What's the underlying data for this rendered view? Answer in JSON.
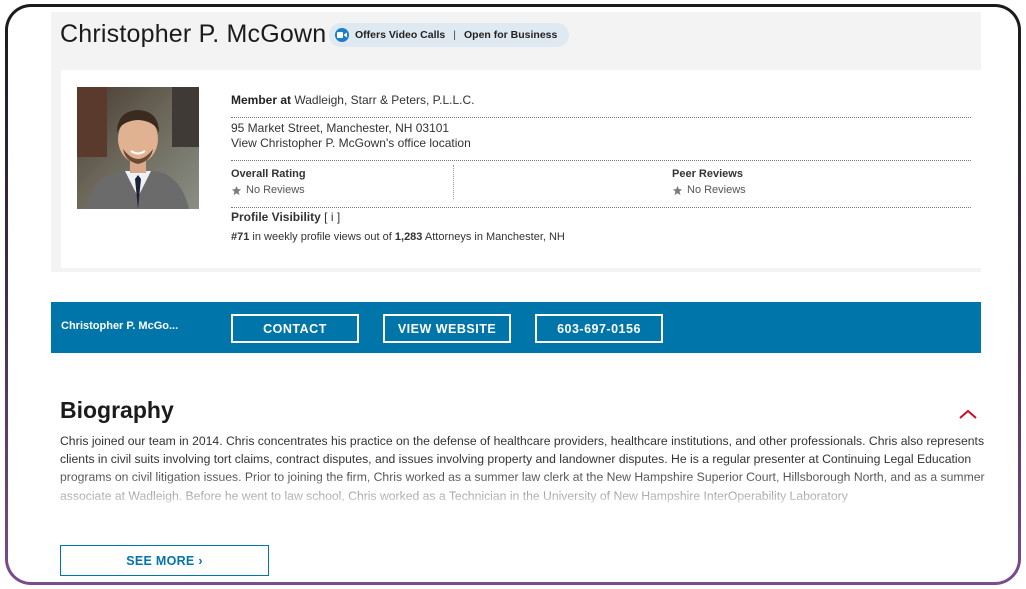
{
  "profile": {
    "name": "Christopher P. McGown",
    "badges": {
      "video": "Offers Video Calls",
      "separator": "|",
      "open": "Open for Business"
    }
  },
  "card": {
    "member_label": "Member at",
    "firm": "Wadleigh, Starr & Peters, P.L.L.C.",
    "address": "95 Market Street, Manchester, NH 03101",
    "office_link": "View Christopher P. McGown's office location",
    "overall_rating_label": "Overall Rating",
    "overall_rating_value": "No Reviews",
    "peer_reviews_label": "Peer Reviews",
    "peer_reviews_value": "No Reviews",
    "visibility_label": "Profile Visibility",
    "visibility_info": "[ i ]",
    "rank": "#71",
    "rank_text_1": "in weekly profile views out of",
    "total": "1,283",
    "rank_text_2": "Attorneys in Manchester, NH"
  },
  "action_bar": {
    "name": "Christopher P. McGo...",
    "contact": "CONTACT",
    "website": "VIEW WEBSITE",
    "phone": "603-697-0156"
  },
  "biography": {
    "title": "Biography",
    "text": "Chris joined our team in 2014. Chris concentrates his practice on the defense of healthcare providers, healthcare institutions, and other professionals. Chris also represents clients in civil suits involving tort claims, contract disputes, and issues involving property and landowner disputes. He is a regular presenter at Continuing Legal Education programs on civil litigation issues. Prior to joining the firm, Chris worked as a summer law clerk at the New Hampshire Superior Court, Hillsborough North, and as a summer associate at Wadleigh. Before he went to law school, Chris worked as a Technician in the University of New Hampshire InterOperability Laboratory",
    "see_more": "SEE MORE ›"
  },
  "colors": {
    "accent": "#0075aa",
    "chevron": "#c8102e",
    "pill_bg": "#dfe9f1"
  },
  "icons": [
    "video-camera-icon",
    "star-icon",
    "chevron-up-icon"
  ]
}
